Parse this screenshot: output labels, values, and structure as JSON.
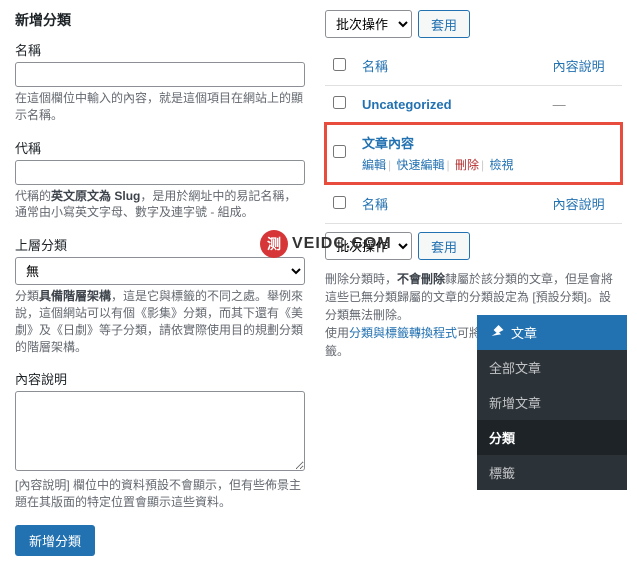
{
  "left": {
    "heading": "新增分類",
    "name_label": "名稱",
    "name_desc": "在這個欄位中輸入的內容，就是這個項目在網站上的顯示名稱。",
    "slug_label": "代稱",
    "slug_desc_prefix": "代稱的",
    "slug_desc_bold": "英文原文為 Slug",
    "slug_desc_suffix": "，是用於網址中的易記名稱，通常由小寫英文字母、數字及連字號 - 組成。",
    "parent_label": "上層分類",
    "parent_option": "無",
    "parent_desc_prefix": "分類",
    "parent_desc_bold": "具備階層架構",
    "parent_desc_suffix": "，這是它與標籤的不同之處。舉例來說，這個網站可以有個《影集》分類，而其下還有《美劇》及《日劇》等子分類，請依實際使用目的規劃分類的階層架構。",
    "desc_label": "內容說明",
    "desc_help": "[內容說明] 欄位中的資料預設不會顯示，但有些佈景主題在其版面的特定位置會顯示這些資料。",
    "submit": "新增分類"
  },
  "right": {
    "bulk_label": "批次操作",
    "apply": "套用",
    "col_name": "名稱",
    "col_desc": "內容說明",
    "rows": [
      {
        "title": "Uncategorized",
        "desc": "—"
      },
      {
        "title": "文章內容",
        "desc": "",
        "actions": {
          "edit": "編輯",
          "quick": "快速編輯",
          "delete": "刪除",
          "view": "檢視"
        }
      }
    ],
    "bulk_label2": "批次操作",
    "note1_prefix": "刪除分類時，",
    "note1_bold": "不會刪除",
    "note1_suffix": "隸屬於該分類的文章，但是會將這些已無分類歸屬的文章的分類設定為 [預設分類]。設分類無法刪除。",
    "note2_prefix": "使用",
    "note2_link": "分類與標籤轉換程式",
    "note2_suffix": "可將分類選擇性地轉換成標籤。"
  },
  "flyout": {
    "head": "文章",
    "items": [
      "全部文章",
      "新增文章",
      "分類",
      "標籤"
    ],
    "active": 2
  },
  "watermark": {
    "badge": "测",
    "text": "VEIDC.COM"
  }
}
